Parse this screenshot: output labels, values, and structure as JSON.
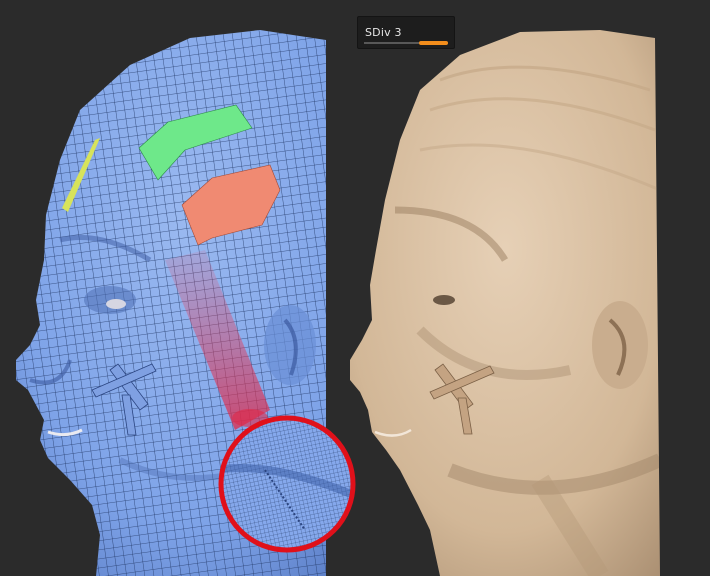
{
  "viewport": {
    "background": "#2b2b2b",
    "left_model": {
      "view": "polyframe-wireframe",
      "base_color": "#7ea3e8",
      "wire_color": "#243a6a",
      "polygroup_green": "#6ee88a",
      "polygroup_red": "#f08a72",
      "polygroup_yellow": "#d7e35a",
      "highlight_color": "#e05070",
      "zoom_lens_ring": "#e0101a"
    },
    "right_model": {
      "view": "shaded-clay",
      "base_color": "#d7bea2"
    }
  },
  "sdiv_slider": {
    "label": "SDiv 3",
    "fill_fraction": 0.35,
    "accent": "#f28d1c"
  }
}
